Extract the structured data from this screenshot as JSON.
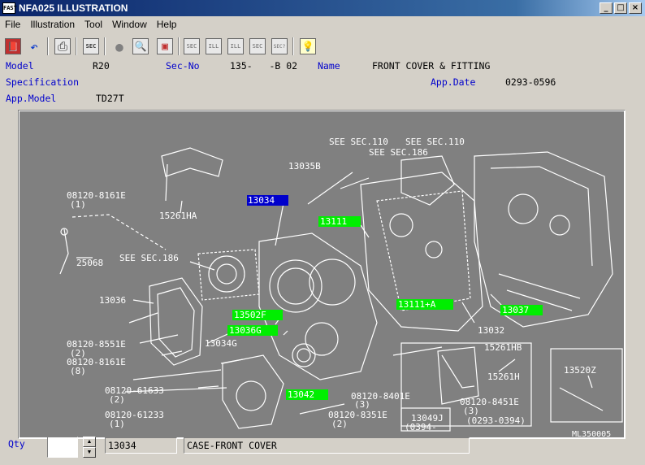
{
  "window": {
    "title": "NFA025 ILLUSTRATION",
    "icon_text": "FAST",
    "buttons": [
      "_",
      "□",
      "×"
    ]
  },
  "menu": [
    "File",
    "Illustration",
    "Tool",
    "Window",
    "Help"
  ],
  "toolbar": {
    "buttons": [
      {
        "name": "book-icon",
        "text": "📕"
      },
      {
        "name": "undo-icon",
        "text": "↶"
      },
      {
        "name": "print-icon",
        "text": "⎙"
      },
      {
        "name": "sec-icon",
        "text": "SEC"
      },
      {
        "name": "circle-icon",
        "text": "●"
      },
      {
        "name": "zoom-icon",
        "text": "🔍"
      },
      {
        "name": "notebook-icon",
        "text": "▣"
      },
      {
        "name": "sec-back-icon",
        "text": "SEC"
      },
      {
        "name": "ill-back-icon",
        "text": "ILL"
      },
      {
        "name": "ill-forward-icon",
        "text": "ILL"
      },
      {
        "name": "sec-forward-icon",
        "text": "SEC"
      },
      {
        "name": "sec-question-icon",
        "text": "SEC?"
      },
      {
        "name": "lightbulb-icon",
        "text": "💡"
      }
    ]
  },
  "header": {
    "model_label": "Model",
    "model_value": "R20",
    "secno_label": "Sec-No",
    "secno_value": "135-   -B 02",
    "name_label": "Name",
    "name_value": "FRONT COVER & FITTING",
    "spec_label": "Specification",
    "appdate_label": "App.Date",
    "appdate_value": "0293-0596",
    "appmodel_label": "App.Model",
    "appmodel_value": "TD27T"
  },
  "illustration": {
    "highlighted": [
      {
        "text": "13034",
        "color": "#0000cc",
        "fg": "#ffffff"
      },
      {
        "text": "13111",
        "color": "#00ee00",
        "fg": "#ffffff"
      },
      {
        "text": "13502F",
        "color": "#00ee00",
        "fg": "#ffffff"
      },
      {
        "text": "13036G",
        "color": "#00ee00",
        "fg": "#ffffff"
      },
      {
        "text": "13111+A",
        "color": "#00ee00",
        "fg": "#ffffff"
      },
      {
        "text": "13037",
        "color": "#00ee00",
        "fg": "#ffffff"
      },
      {
        "text": "13042",
        "color": "#00ee00",
        "fg": "#ffffff"
      }
    ],
    "labels": [
      "SEE SEC.110",
      "SEE SEC.110",
      "SEE SEC.186",
      "13035B",
      "08120-8161E",
      "(1)",
      "15261HA",
      "25068",
      "SEE SEC.186",
      "13036",
      "08120-8551E",
      "(2)",
      "08120-8161E",
      "(8)",
      "13034G",
      "08120-61633",
      "(2)",
      "08120-61233",
      "(1)",
      "13032",
      "15261HB",
      "15261H",
      "13520Z",
      "08120-8401E",
      "(3)",
      "08120-8451E",
      "(3)",
      "(0293-0394)",
      "13049J",
      "(0394-",
      "08120-8351E",
      "(2)",
      "ML350005"
    ]
  },
  "footer": {
    "qty_label": "Qty",
    "qty_value": "",
    "part_no": "13034",
    "part_name": "CASE-FRONT COVER"
  }
}
